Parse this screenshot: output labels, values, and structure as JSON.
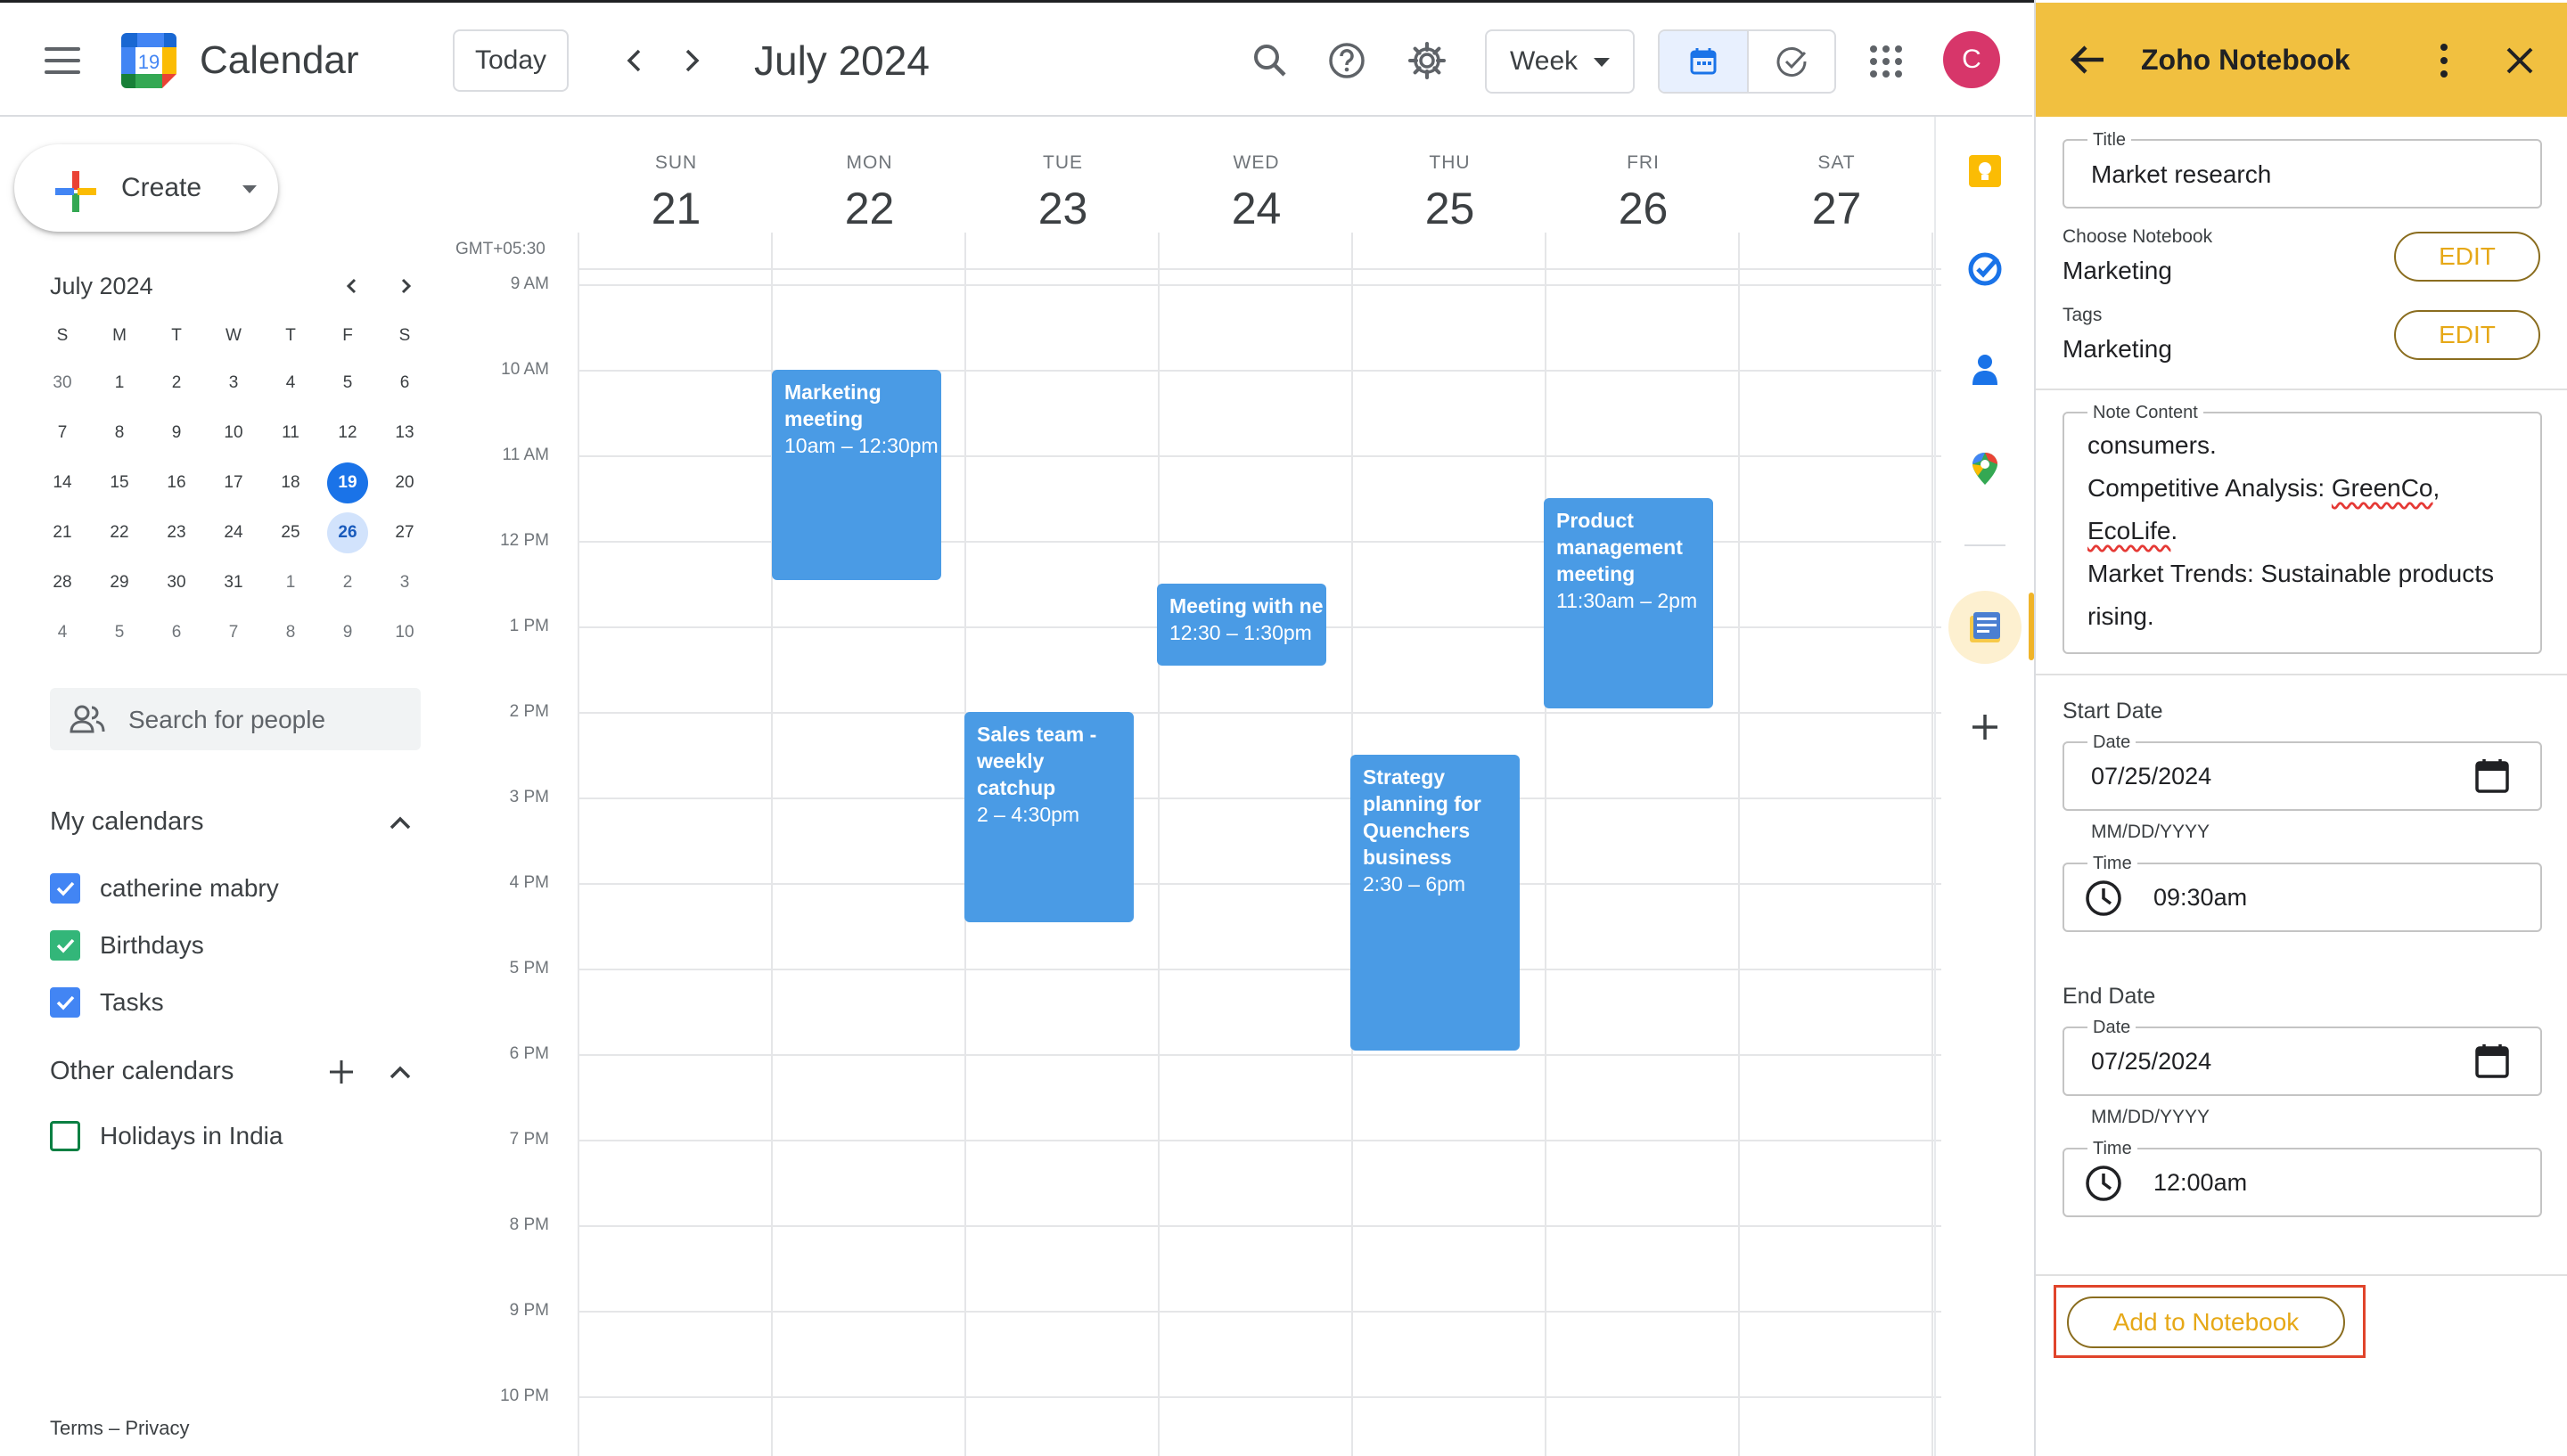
{
  "header": {
    "app_title": "Calendar",
    "logo_day": "19",
    "today_label": "Today",
    "current_range": "July 2024",
    "view_label": "Week",
    "avatar_initial": "C"
  },
  "sidebar": {
    "create_label": "Create",
    "mini_calendar": {
      "title": "July 2024",
      "weekday_headers": [
        "S",
        "M",
        "T",
        "W",
        "T",
        "F",
        "S"
      ],
      "weeks": [
        [
          "30",
          "1",
          "2",
          "3",
          "4",
          "5",
          "6"
        ],
        [
          "7",
          "8",
          "9",
          "10",
          "11",
          "12",
          "13"
        ],
        [
          "14",
          "15",
          "16",
          "17",
          "18",
          "19",
          "20"
        ],
        [
          "21",
          "22",
          "23",
          "24",
          "25",
          "26",
          "27"
        ],
        [
          "28",
          "29",
          "30",
          "31",
          "1",
          "2",
          "3"
        ],
        [
          "4",
          "5",
          "6",
          "7",
          "8",
          "9",
          "10"
        ]
      ],
      "today": "19",
      "selected": "26"
    },
    "search_people_placeholder": "Search for people",
    "my_calendars": {
      "title": "My calendars",
      "items": [
        {
          "label": "catherine mabry",
          "color": "#4285f4",
          "checked": true
        },
        {
          "label": "Birthdays",
          "color": "#33b679",
          "checked": true
        },
        {
          "label": "Tasks",
          "color": "#4285f4",
          "checked": true
        }
      ]
    },
    "other_calendars": {
      "title": "Other calendars",
      "items": [
        {
          "label": "Holidays in India",
          "color": "#0b8043",
          "checked": false
        }
      ]
    },
    "footer": "Terms – Privacy"
  },
  "week": {
    "timezone": "GMT+05:30",
    "days": [
      {
        "name": "SUN",
        "num": "21"
      },
      {
        "name": "MON",
        "num": "22"
      },
      {
        "name": "TUE",
        "num": "23"
      },
      {
        "name": "WED",
        "num": "24"
      },
      {
        "name": "THU",
        "num": "25"
      },
      {
        "name": "FRI",
        "num": "26"
      },
      {
        "name": "SAT",
        "num": "27"
      }
    ],
    "hours": [
      "9 AM",
      "10 AM",
      "11 AM",
      "12 PM",
      "1 PM",
      "2 PM",
      "3 PM",
      "4 PM",
      "5 PM",
      "6 PM",
      "7 PM",
      "8 PM",
      "9 PM",
      "10 PM"
    ],
    "events": [
      {
        "title": "Marketing meeting",
        "time": "10am – 12:30pm"
      },
      {
        "title": "Meeting with ne",
        "time": "12:30 – 1:30pm"
      },
      {
        "title": "Sales team - weekly catchup",
        "time": "2 – 4:30pm"
      },
      {
        "title": "Strategy planning for Quenchers business",
        "time": "2:30 – 6pm"
      },
      {
        "title": "Product management meeting",
        "time": "11:30am – 2pm"
      }
    ],
    "event_color": "#4a9be5"
  },
  "panel": {
    "title": "Zoho Notebook",
    "accent_color": "#f1c040",
    "title_field": {
      "legend": "Title",
      "value": "Market research"
    },
    "notebook": {
      "label": "Choose Notebook",
      "value": "Marketing",
      "edit": "EDIT"
    },
    "tags": {
      "label": "Tags",
      "value": "Marketing",
      "edit": "EDIT"
    },
    "note_content": {
      "legend": "Note Content",
      "line1": "consumers.",
      "line2a": "Competitive Analysis: ",
      "line2b": "GreenCo",
      "line2c": ",",
      "line3a": "EcoLife",
      "line3b": ".",
      "line4": "Market Trends: Sustainable products",
      "line5": "rising."
    },
    "start": {
      "label": "Start Date",
      "date_legend": "Date",
      "date": "07/25/2024",
      "format": "MM/DD/YYYY",
      "time_legend": "Time",
      "time": "09:30am"
    },
    "end": {
      "label": "End Date",
      "date_legend": "Date",
      "date": "07/25/2024",
      "format": "MM/DD/YYYY",
      "time_legend": "Time",
      "time": "12:00am"
    },
    "add_button": "Add to Notebook"
  }
}
